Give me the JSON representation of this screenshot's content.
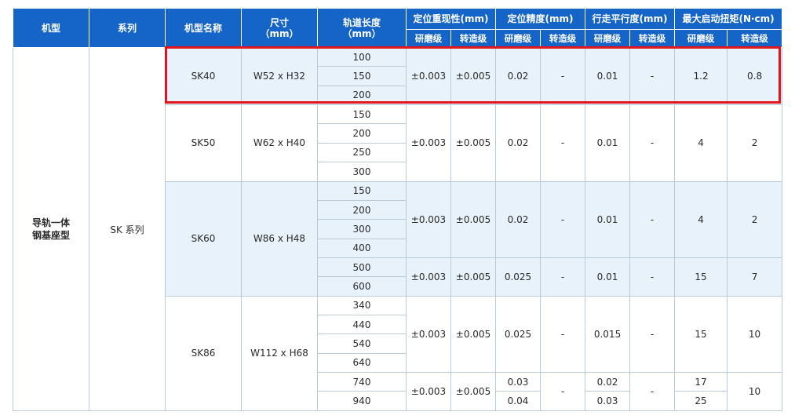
{
  "header": {
    "model": "机型",
    "series": "系列",
    "model_name": "机型名称",
    "size_line1": "尺寸",
    "size_line2": "（mm）",
    "rail_line1": "轨道长度",
    "rail_line2": "（mm）",
    "repeatability": "定位重现性(mm)",
    "accuracy": "定位精度(mm)",
    "parallelism": "行走平行度(mm)",
    "torque": "最大启动扭矩(N·cm)",
    "grinding": "研磨级",
    "rolling": "转造级"
  },
  "common": {
    "model_line1": "导轨一体",
    "model_line2": "钢基座型",
    "series": "SK 系列"
  },
  "dash": "-",
  "groups": {
    "sk40": {
      "name": "SK40",
      "size": "W52 x H32",
      "lengths": [
        "100",
        "150",
        "200"
      ],
      "rep_g": "±0.003",
      "rep_r": "±0.005",
      "acc_g": "0.02",
      "par_g": "0.01",
      "torque_g": "1.2",
      "torque_r": "0.8"
    },
    "sk50": {
      "name": "SK50",
      "size": "W62 x H40",
      "lengths": [
        "150",
        "200",
        "250",
        "300"
      ],
      "rep_g": "±0.003",
      "rep_r": "±0.005",
      "acc_g": "0.02",
      "par_g": "0.01",
      "torque_g": "4",
      "torque_r": "2"
    },
    "sk60": {
      "name": "SK60",
      "size": "W86 x H48",
      "lengths": [
        "150",
        "200",
        "300",
        "400",
        "500",
        "600"
      ],
      "a": {
        "rep_g": "±0.003",
        "rep_r": "±0.005",
        "acc_g": "0.02",
        "par_g": "0.01",
        "torque_g": "4",
        "torque_r": "2"
      },
      "b": {
        "rep_g": "±0.003",
        "rep_r": "±0.005",
        "acc_g": "0.025",
        "par_g": "0.01",
        "torque_g": "15",
        "torque_r": "7"
      }
    },
    "sk86": {
      "name": "SK86",
      "size": "W112 x H68",
      "lengths": [
        "340",
        "440",
        "540",
        "640",
        "740",
        "940"
      ],
      "a": {
        "rep_g": "±0.003",
        "rep_r": "±0.005",
        "acc_g": "0.025",
        "par_g": "0.015",
        "torque_g": "15",
        "torque_r": "10"
      },
      "b": {
        "rep_g": "±0.003",
        "rep_r": "±0.005",
        "acc_g_740": "0.03",
        "acc_g_940": "0.04",
        "par_g_740": "0.02",
        "par_g_940": "0.03",
        "torque_g_740": "17",
        "torque_g_940": "25",
        "torque_r": "10"
      }
    }
  },
  "highlight": {
    "color": "#e4141d",
    "target": "SK40"
  },
  "colors": {
    "header": "#1565c8",
    "row_alt": "#e7f2fb",
    "border": "#b9cbd9"
  }
}
